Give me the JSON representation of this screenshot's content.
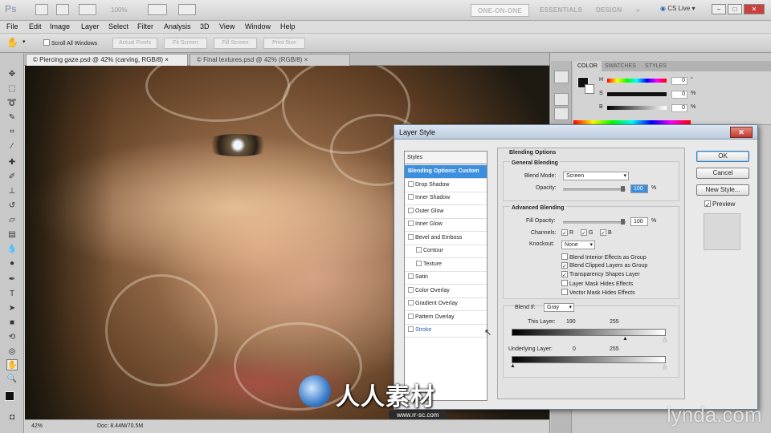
{
  "app": {
    "logo": "Ps",
    "zoom": "100%",
    "workspaces": [
      "ONE-ON-ONE",
      "ESSENTIALS",
      "DESIGN",
      "»"
    ],
    "cs_live": "CS Live"
  },
  "menus": [
    "File",
    "Edit",
    "Image",
    "Layer",
    "Select",
    "Filter",
    "Analysis",
    "3D",
    "View",
    "Window",
    "Help"
  ],
  "options_bar": {
    "scroll_all": "Scroll All Windows",
    "actual_pixels": "Actual Pixels",
    "fit_screen": "Fit Screen",
    "fill_screen": "Fill Screen",
    "print_size": "Print Size"
  },
  "doc_tabs": [
    "© Piercing gaze.psd @ 42% (carving, RGB/8) ×",
    "© Final textures.psd @ 42% (RGB/8) ×"
  ],
  "status": {
    "zoom": "42%",
    "doc": "Doc: 8.44M/70.5M"
  },
  "color_panel": {
    "tabs": [
      "COLOR",
      "SWATCHES",
      "STYLES"
    ],
    "rows": [
      {
        "label": "H",
        "value": "0",
        "unit": "°"
      },
      {
        "label": "S",
        "value": "0",
        "unit": "%"
      },
      {
        "label": "B",
        "value": "0",
        "unit": "%"
      }
    ]
  },
  "dialog": {
    "title": "Layer Style",
    "styles_header": "Styles",
    "styles": [
      {
        "label": "Blending Options: Custom",
        "selected": true
      },
      {
        "label": "Drop Shadow"
      },
      {
        "label": "Inner Shadow"
      },
      {
        "label": "Outer Glow"
      },
      {
        "label": "Inner Glow"
      },
      {
        "label": "Bevel and Emboss"
      },
      {
        "label": "Contour",
        "indent": true
      },
      {
        "label": "Texture",
        "indent": true
      },
      {
        "label": "Satin"
      },
      {
        "label": "Color Overlay"
      },
      {
        "label": "Gradient Overlay"
      },
      {
        "label": "Pattern Overlay"
      },
      {
        "label": "Stroke"
      }
    ],
    "blending_options": "Blending Options",
    "general_blending": "General Blending",
    "blend_mode_label": "Blend Mode:",
    "blend_mode": "Screen",
    "opacity_label": "Opacity:",
    "opacity": "100",
    "advanced_blending": "Advanced Blending",
    "fill_opacity_label": "Fill Opacity:",
    "fill_opacity": "100",
    "channels_label": "Channels:",
    "channels": [
      "R",
      "G",
      "B"
    ],
    "knockout_label": "Knockout:",
    "knockout": "None",
    "checks": [
      {
        "label": "Blend Interior Effects as Group",
        "checked": false
      },
      {
        "label": "Blend Clipped Layers as Group",
        "checked": true
      },
      {
        "label": "Transparency Shapes Layer",
        "checked": true
      },
      {
        "label": "Layer Mask Hides Effects",
        "checked": false
      },
      {
        "label": "Vector Mask Hides Effects",
        "checked": false
      }
    ],
    "blend_if_label": "Blend If:",
    "blend_if": "Gray",
    "this_layer_label": "This Layer:",
    "this_layer_low": "190",
    "this_layer_high": "255",
    "underlying_label": "Underlying Layer:",
    "underlying_low": "0",
    "underlying_high": "255",
    "percent": "%",
    "ok": "OK",
    "cancel": "Cancel",
    "new_style": "New Style...",
    "preview": "Preview"
  },
  "watermarks": {
    "cn_text": "人人素材",
    "url": "www.rr-sc.com",
    "lynda": "lynda.com"
  }
}
